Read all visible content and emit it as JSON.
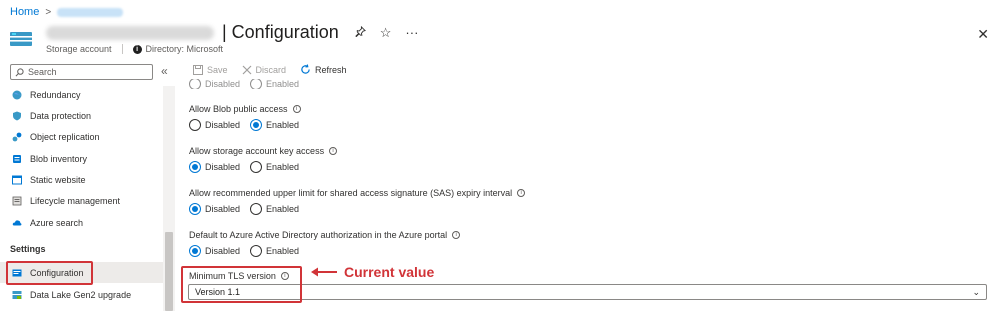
{
  "breadcrumb": {
    "home": "Home",
    "separator": ">"
  },
  "header": {
    "title": "| Configuration",
    "resource_type": "Storage account",
    "directory": "Directory: Microsoft",
    "actions": {
      "pin": "pin-icon",
      "favorite": "star-icon",
      "more": "···"
    }
  },
  "sidebar": {
    "search_placeholder": "Search",
    "collapse_glyph": "«",
    "items": [
      {
        "label": "Redundancy"
      },
      {
        "label": "Data protection"
      },
      {
        "label": "Object replication"
      },
      {
        "label": "Blob inventory"
      },
      {
        "label": "Static website"
      },
      {
        "label": "Lifecycle management"
      },
      {
        "label": "Azure search"
      }
    ],
    "section": "Settings",
    "settings_items": [
      {
        "label": "Configuration"
      },
      {
        "label": "Data Lake Gen2 upgrade"
      }
    ]
  },
  "toolbar": {
    "save": "Save",
    "discard": "Discard",
    "refresh": "Refresh"
  },
  "options": {
    "disabled": "Disabled",
    "enabled": "Enabled"
  },
  "fields": [
    {
      "label": "Allow Blob public access",
      "selected": "Enabled"
    },
    {
      "label": "Allow storage account key access",
      "selected": "Disabled"
    },
    {
      "label": "Allow recommended upper limit for shared access signature (SAS) expiry interval",
      "selected": "Disabled"
    },
    {
      "label": "Default to Azure Active Directory authorization in the Azure portal",
      "selected": "Disabled"
    }
  ],
  "tls": {
    "label": "Minimum TLS version",
    "value": "Version 1.1"
  },
  "annotation": {
    "text": "Current value"
  },
  "colors": {
    "accent": "#0078d4",
    "highlight": "#d13438"
  }
}
